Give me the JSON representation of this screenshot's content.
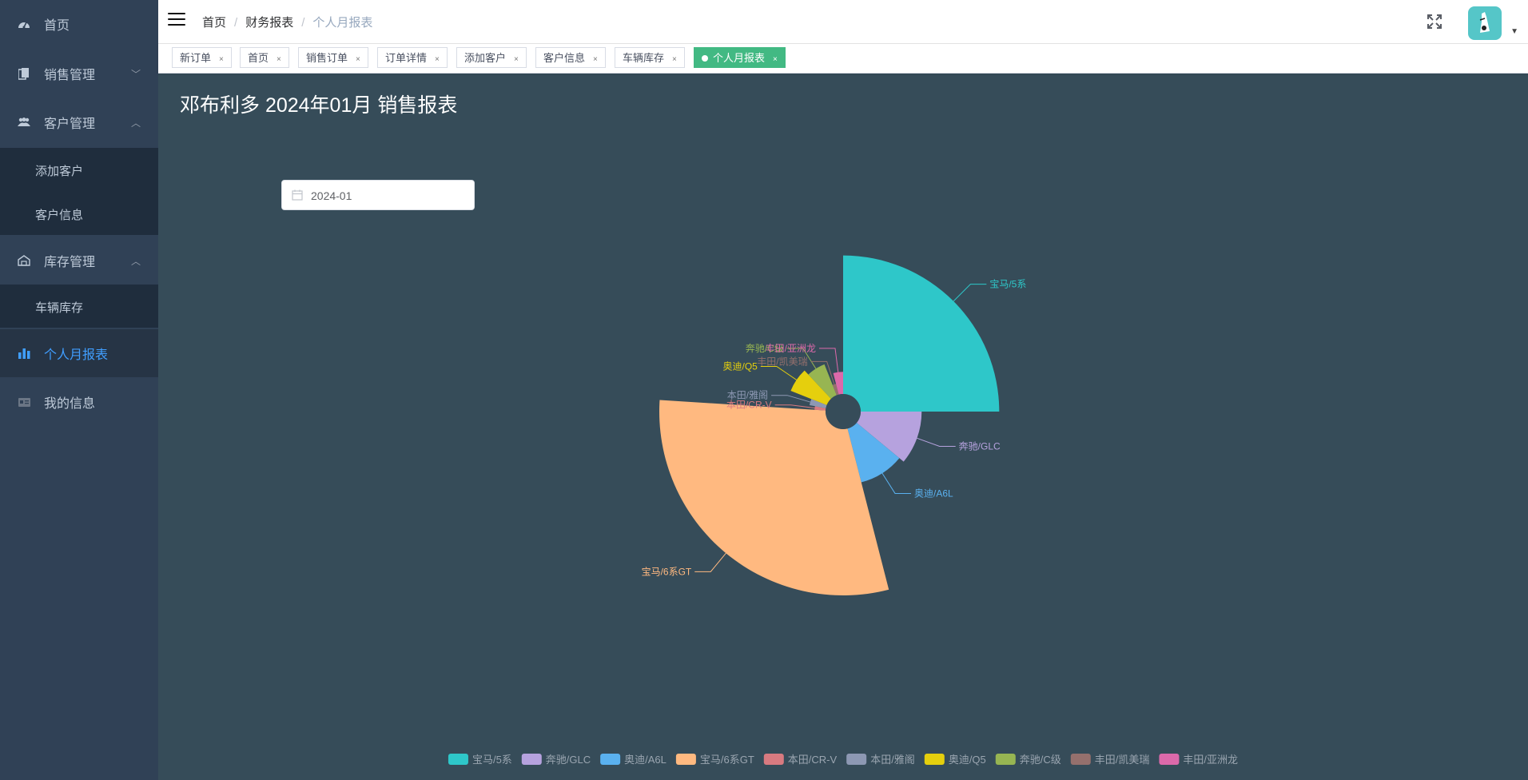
{
  "sidebar": {
    "items": [
      {
        "label": "首页",
        "icon": "dashboard-icon"
      },
      {
        "label": "销售管理",
        "icon": "documents-icon",
        "arrow": "﹀"
      },
      {
        "label": "客户管理",
        "icon": "peoples-icon",
        "arrow": "︿"
      },
      {
        "label": "库存管理",
        "icon": "warehouse-icon",
        "arrow": "︿"
      },
      {
        "label": "个人月报表",
        "icon": "bar-chart-icon"
      },
      {
        "label": "我的信息",
        "icon": "id-card-icon"
      }
    ],
    "customer_sub": [
      "添加客户",
      "客户信息"
    ],
    "inventory_sub": [
      "车辆库存"
    ]
  },
  "header": {
    "breadcrumb": [
      "首页",
      "财务报表",
      "个人月报表"
    ],
    "separator": "/"
  },
  "tags": [
    {
      "label": "新订单"
    },
    {
      "label": "首页"
    },
    {
      "label": "销售订单"
    },
    {
      "label": "订单详情"
    },
    {
      "label": "添加客户"
    },
    {
      "label": "客户信息"
    },
    {
      "label": "车辆库存"
    },
    {
      "label": "个人月报表",
      "active": true
    }
  ],
  "tag_close": "×",
  "main": {
    "title": "邓布利多 2024年01月 销售报表",
    "date_value": "2024-01"
  },
  "chart_data": {
    "type": "pie",
    "variant": "rose",
    "colors": [
      "#2ec7c9",
      "#b6a2de",
      "#5ab1ef",
      "#ffb980",
      "#d87a80",
      "#8d98b3",
      "#e5cf0d",
      "#97b552",
      "#95706d",
      "#dc69aa"
    ],
    "slices": [
      {
        "label": "宝马/5系",
        "value": 25
      },
      {
        "label": "奔驰/GLC",
        "value": 11
      },
      {
        "label": "奥迪/A6L",
        "value": 10
      },
      {
        "label": "宝马/6系GT",
        "value": 30
      },
      {
        "label": "本田/CR-V",
        "value": 2
      },
      {
        "label": "本田/雅阁",
        "value": 3
      },
      {
        "label": "奥迪/Q5",
        "value": 7
      },
      {
        "label": "奔驰/C级",
        "value": 6
      },
      {
        "label": "丰田/凯美瑞",
        "value": 2
      },
      {
        "label": "丰田/亚洲龙",
        "value": 4
      }
    ],
    "legend_position": "bottom"
  }
}
